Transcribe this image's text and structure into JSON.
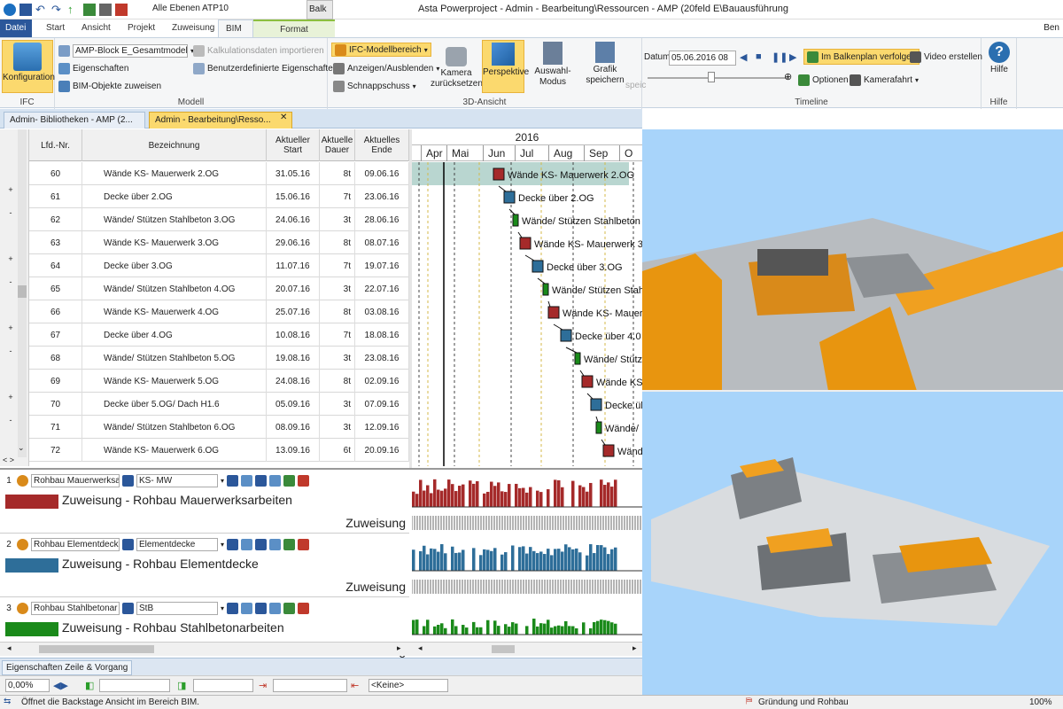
{
  "qat": {
    "layers": "Alle Ebenen   ATP10",
    "balk_label": "Balk"
  },
  "title": "Asta Powerproject - Admin - Bearbeitung\\Ressourcen - AMP (20feld E\\Bauausführung",
  "user": "Ben",
  "tabs": [
    "Datei",
    "Start",
    "Ansicht",
    "Projekt",
    "Zuweisung",
    "BIM",
    "Format"
  ],
  "ribbon": {
    "ifc": {
      "btn": "Konfiguration",
      "group": "IFC"
    },
    "modell": {
      "combo": "AMP-Block E_Gesamtmodell_2",
      "kalk": "Kalkulationsdaten importieren",
      "eigenschaften": "Eigenschaften",
      "benutzer": "Benutzerdefinierte Eigenschaften",
      "zuweisen": "BIM-Objekte zuweisen",
      "group": "Modell"
    },
    "ansicht3d": {
      "ifc_bereich": "IFC-Modellbereich",
      "anzeigen": "Anzeigen/Ausblenden",
      "schnapp": "Schnappschuss",
      "kamera": "Kamera zurücksetzen",
      "perspektive": "Perspektive",
      "auswahl": "Auswahl-Modus",
      "grafik": "Grafik speichern",
      "speich": "speic",
      "group": "3D-Ansicht"
    },
    "timeline": {
      "datum_label": "Datum",
      "datum": "05.06.2016 08",
      "follow": "Im Balkenplan verfolgen",
      "video": "Video erstellen",
      "optionen": "Optionen",
      "kamerafahrt": "Kamerafahrt",
      "group": "Timeline"
    },
    "hilfe": {
      "btn": "Hilfe",
      "group": "Hilfe"
    }
  },
  "doctabs": [
    "Admin- Bibliotheken - AMP (2...",
    "Admin - Bearbeitung\\Resso..."
  ],
  "grid": {
    "headers": {
      "nr": "Lfd.-Nr.",
      "bez": "Bezeichnung",
      "start": "Aktueller Start",
      "dauer": "Aktuelle Dauer",
      "ende": "Aktuelles Ende"
    },
    "rows": [
      {
        "sign": "",
        "nr": "60",
        "bez": "Wände KS- Mauerwerk 2.OG",
        "start": "31.05.16",
        "dauer": "8t",
        "ende": "09.06.16"
      },
      {
        "sign": "+",
        "nr": "61",
        "bez": "Decke über 2.OG",
        "start": "15.06.16",
        "dauer": "7t",
        "ende": "23.06.16"
      },
      {
        "sign": "-",
        "nr": "62",
        "bez": "Wände/ Stützen Stahlbeton 3.OG",
        "start": "24.06.16",
        "dauer": "3t",
        "ende": "28.06.16"
      },
      {
        "sign": "",
        "nr": "63",
        "bez": "Wände KS- Mauerwerk 3.OG",
        "start": "29.06.16",
        "dauer": "8t",
        "ende": "08.07.16"
      },
      {
        "sign": "+",
        "nr": "64",
        "bez": "Decke über 3.OG",
        "start": "11.07.16",
        "dauer": "7t",
        "ende": "19.07.16"
      },
      {
        "sign": "-",
        "nr": "65",
        "bez": "Wände/ Stützen Stahlbeton 4.OG",
        "start": "20.07.16",
        "dauer": "3t",
        "ende": "22.07.16"
      },
      {
        "sign": "",
        "nr": "66",
        "bez": "Wände KS- Mauerwerk 4.OG",
        "start": "25.07.16",
        "dauer": "8t",
        "ende": "03.08.16"
      },
      {
        "sign": "+",
        "nr": "67",
        "bez": "Decke über 4.OG",
        "start": "10.08.16",
        "dauer": "7t",
        "ende": "18.08.16"
      },
      {
        "sign": "-",
        "nr": "68",
        "bez": "Wände/ Stützen Stahlbeton 5.OG",
        "start": "19.08.16",
        "dauer": "3t",
        "ende": "23.08.16"
      },
      {
        "sign": "",
        "nr": "69",
        "bez": "Wände KS- Mauerwerk 5.OG",
        "start": "24.08.16",
        "dauer": "8t",
        "ende": "02.09.16"
      },
      {
        "sign": "+",
        "nr": "70",
        "bez": "Decke über 5.OG/ Dach H1.6",
        "start": "05.09.16",
        "dauer": "3t",
        "ende": "07.09.16"
      },
      {
        "sign": "-",
        "nr": "71",
        "bez": "Wände/ Stützen Stahlbeton 6.OG",
        "start": "08.09.16",
        "dauer": "3t",
        "ende": "12.09.16"
      },
      {
        "sign": "",
        "nr": "72",
        "bez": "Wände KS- Mauerwerk 6.OG",
        "start": "13.09.16",
        "dauer": "6t",
        "ende": "20.09.16"
      }
    ]
  },
  "gantt": {
    "year": "2016",
    "months": [
      "Apr",
      "Mai",
      "Jun",
      "Jul",
      "Aug",
      "Sep",
      "O"
    ],
    "labels": [
      "Wände KS- Mauerwerk 2.OG",
      "Decke über 2.OG",
      "Wände/ Stützen Stahlbeton",
      "Wände KS- Mauerwerk 3",
      "Decke über 3.OG",
      "Wände/ Stützen Stahl",
      "Wände KS- Mauer",
      "Decke über 4.0",
      "Wände/ Stütz",
      "Wände KS",
      "Decke üb",
      "Wände/",
      "Wänd"
    ],
    "colors": {
      "mauerwerk": "#a52a2a",
      "decke": "#2e6e99",
      "stb": "#1a8a1a"
    }
  },
  "histograms": [
    {
      "n": "1",
      "res": "Rohbau Mauerwerksa",
      "code": "KS- MW",
      "legend": "Zuweisung - Rohbau Mauerwerksarbeiten",
      "color": "#a52a2a",
      "axis_top": "5-",
      "axis_bot": "0-",
      "zuw": "Zuweisung"
    },
    {
      "n": "2",
      "res": "Rohbau Elementdecke",
      "code": "Elementdecke",
      "legend": "Zuweisung - Rohbau Elementdecke",
      "color": "#2e6e99",
      "axis_top": "",
      "axis_bot": "0-",
      "zuw": "Zuweisung"
    },
    {
      "n": "3",
      "res": "Rohbau Stahlbetonar",
      "code": "StB",
      "legend": "Zuweisung - Rohbau Stahlbetonarbeiten",
      "color": "#1a8a1a",
      "axis_top": "",
      "axis_bot": "0-",
      "zuw": "Zuweisung"
    }
  ],
  "props_tab": "Eigenschaften Zeile & Vorgang",
  "formatbar": {
    "zoom": "0,00%",
    "keine": "<Keine>"
  },
  "status": {
    "left": "Öffnet die Backstage Ansicht im Bereich BIM.",
    "right": "Gründung und Rohbau",
    "zoom": "100%"
  }
}
